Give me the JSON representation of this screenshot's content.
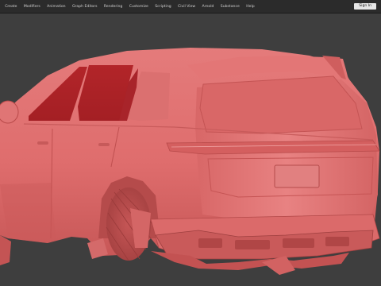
{
  "app": {
    "menu": [
      "Create",
      "Modifiers",
      "Animation",
      "Graph Editors",
      "Rendering",
      "Customize",
      "Scripting",
      "Civil View",
      "Arnold",
      "Substance",
      "Help"
    ],
    "sign_in_label": "Sign In"
  },
  "viewport": {
    "background_color": "#3e3e3e",
    "model_color": "#e06a6a",
    "window_tint_color": "#b52a2e"
  }
}
